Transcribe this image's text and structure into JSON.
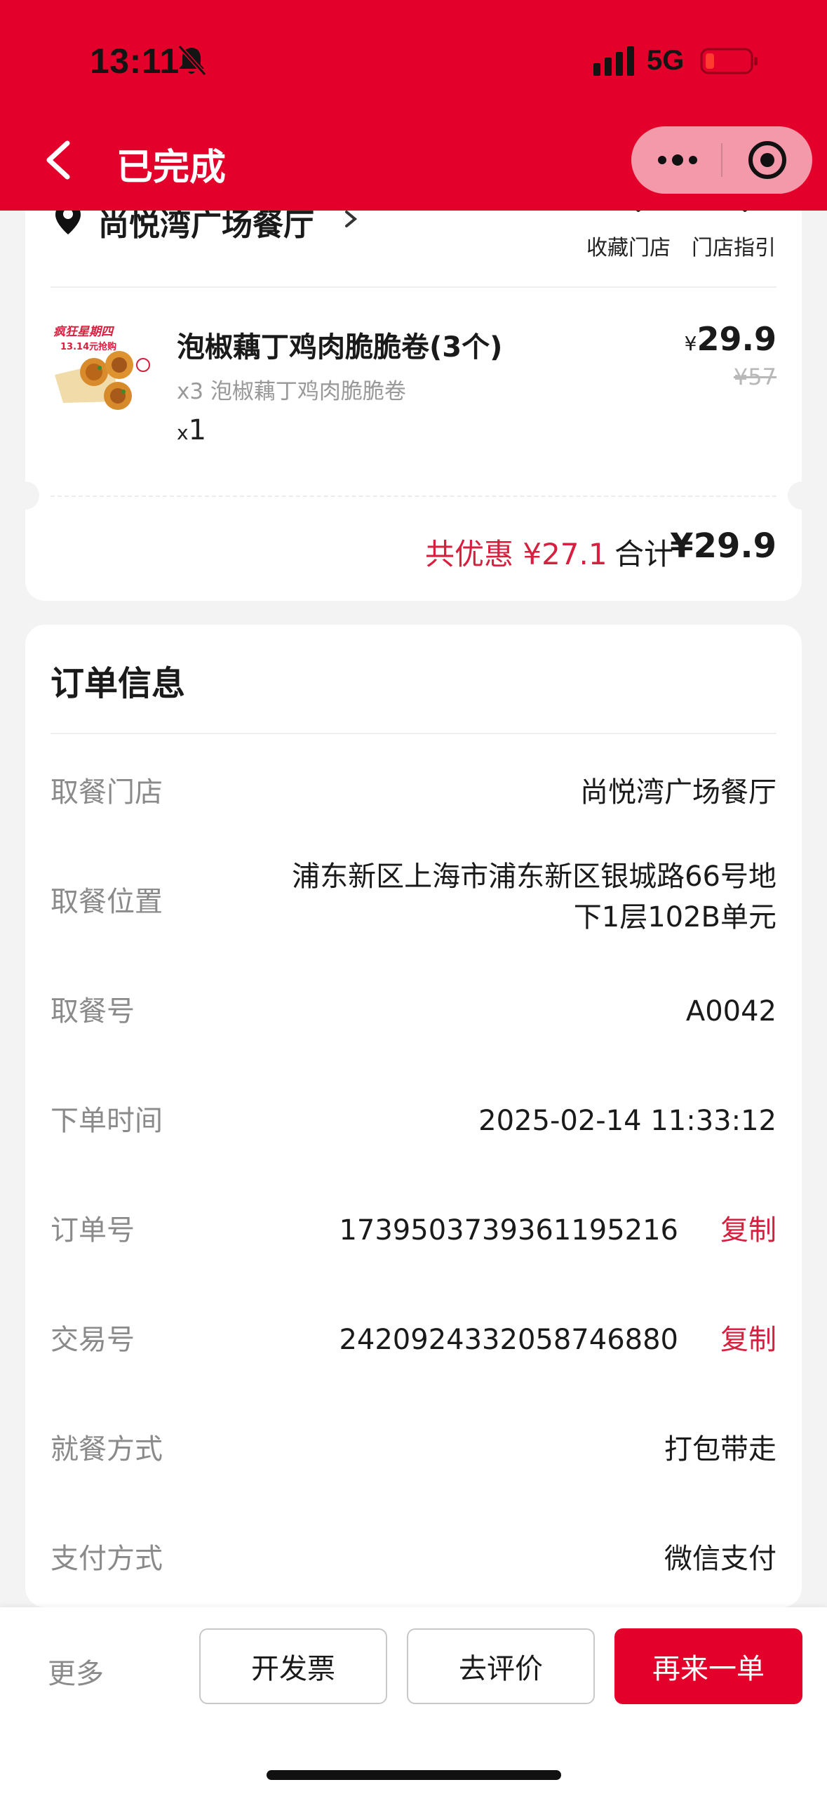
{
  "status_bar": {
    "time": "13:11",
    "network": "5G"
  },
  "nav": {
    "title": "已完成"
  },
  "store": {
    "name": "尚悦湾广场餐厅",
    "favorite_label": "收藏门店",
    "guide_label": "门店指引"
  },
  "item": {
    "name": "泡椒藕丁鸡肉脆脆卷(3个)",
    "sub": "x3 泡椒藕丁鸡肉脆脆卷",
    "qty_prefix": "x",
    "qty": "1",
    "currency": "¥",
    "price": "29.9",
    "original_price": "¥57",
    "image_caption": "疯狂星期四 13.14元抢购"
  },
  "summary": {
    "discount": "共优惠 ¥27.1",
    "total_label": "合计",
    "total_value": "¥29.9"
  },
  "order_info": {
    "title": "订单信息",
    "rows": [
      {
        "label": "取餐门店",
        "value": "尚悦湾广场餐厅"
      },
      {
        "label": "取餐位置",
        "value_line1": "浦东新区上海市浦东新区银城路66号地",
        "value_line2": "下1层102B单元"
      },
      {
        "label": "取餐号",
        "value": "A0042"
      },
      {
        "label": "下单时间",
        "value": "2025-02-14 11:33:12"
      },
      {
        "label": "订单号",
        "value": "1739503739361195216",
        "action": "复制"
      },
      {
        "label": "交易号",
        "value": "2420924332058746880",
        "action": "复制"
      },
      {
        "label": "就餐方式",
        "value": "打包带走"
      },
      {
        "label": "支付方式",
        "value": "微信支付"
      }
    ]
  },
  "bottom": {
    "more": "更多",
    "invoice": "开发票",
    "review": "去评价",
    "reorder": "再来一单"
  },
  "colors": {
    "brand_red": "#e3002b",
    "accent_red": "#d6203f",
    "label_gray": "#8a8a8a"
  },
  "icons": [
    "bell-slash-icon",
    "signal-icon",
    "battery-icon",
    "back-icon",
    "more-dots-icon",
    "target-icon",
    "location-pin-icon",
    "chevron-right-icon",
    "favorite-icon",
    "guide-icon"
  ]
}
